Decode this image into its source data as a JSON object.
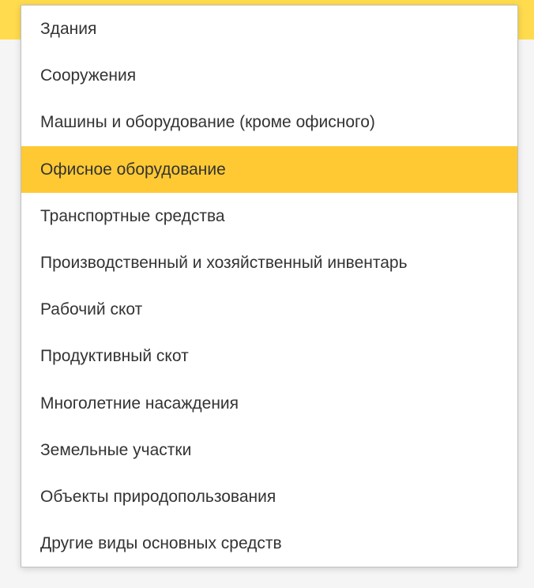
{
  "dropdown": {
    "items": [
      {
        "label": "Здания",
        "selected": false
      },
      {
        "label": "Сооружения",
        "selected": false
      },
      {
        "label": "Машины и оборудование (кроме офисного)",
        "selected": false
      },
      {
        "label": "Офисное оборудование",
        "selected": true
      },
      {
        "label": "Транспортные средства",
        "selected": false
      },
      {
        "label": "Производственный и хозяйственный инвентарь",
        "selected": false
      },
      {
        "label": "Рабочий скот",
        "selected": false
      },
      {
        "label": "Продуктивный скот",
        "selected": false
      },
      {
        "label": "Многолетние насаждения",
        "selected": false
      },
      {
        "label": "Земельные участки",
        "selected": false
      },
      {
        "label": "Объекты природопользования",
        "selected": false
      },
      {
        "label": "Другие виды основных средств",
        "selected": false
      }
    ]
  }
}
